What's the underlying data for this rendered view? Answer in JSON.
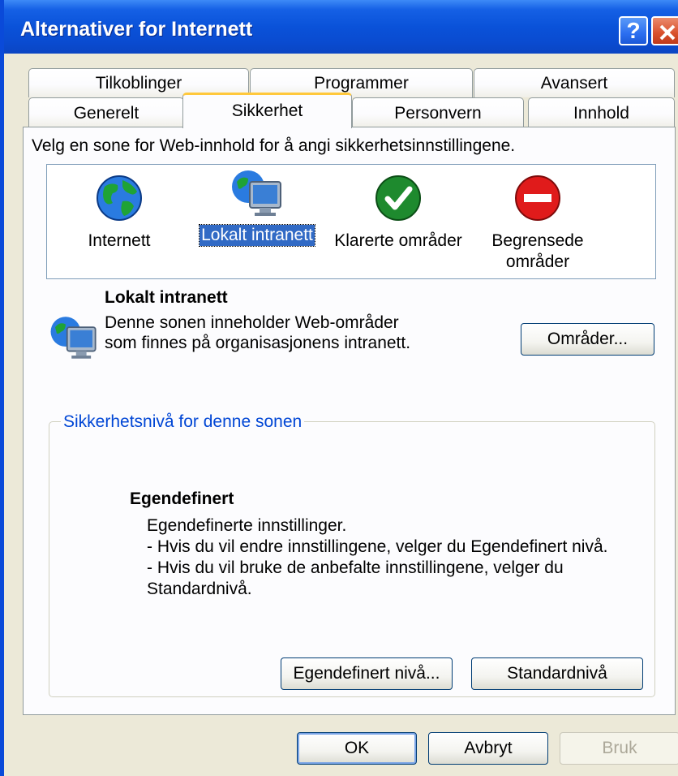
{
  "window": {
    "title": "Alternativer for Internett",
    "help_glyph": "?",
    "colors": {
      "titlebar": "#0a52d9",
      "close": "#d9502c",
      "selection": "#316ac5",
      "group_title": "#0046d5"
    }
  },
  "tabs": {
    "row_back": [
      "Tilkoblinger",
      "Programmer",
      "Avansert"
    ],
    "row_front": [
      "Generelt",
      "Sikkerhet",
      "Personvern",
      "Innhold"
    ],
    "active": "Sikkerhet"
  },
  "instruction": "Velg en sone for Web-innhold for å angi sikkerhetsinnstillingene.",
  "zones": [
    {
      "label": "Internett",
      "icon": "globe-icon"
    },
    {
      "label": "Lokalt intranett",
      "icon": "intranet-computer-icon",
      "selected": true
    },
    {
      "label": "Klarerte områder",
      "icon": "checkmark-icon"
    },
    {
      "label": "Begrensede\nområder",
      "icon": "restricted-icon"
    }
  ],
  "zone_info": {
    "title": "Lokalt intranett",
    "description_line1": "Denne sonen inneholder Web-områder",
    "description_line2": "som finnes på organisasjonens intranett.",
    "sites_button": "Områder..."
  },
  "security_level": {
    "group_title": "Sikkerhetsnivå for denne sonen",
    "level_name": "Egendefinert",
    "lines": [
      "Egendefinerte innstillinger.",
      "- Hvis du vil endre innstillingene, velger du Egendefinert nivå.",
      "- Hvis du vil bruke de anbefalte innstillingene, velger du",
      "Standardnivå."
    ],
    "custom_button": "Egendefinert nivå...",
    "default_button": "Standardnivå"
  },
  "footer": {
    "ok": "OK",
    "cancel": "Avbryt",
    "apply": "Bruk"
  }
}
